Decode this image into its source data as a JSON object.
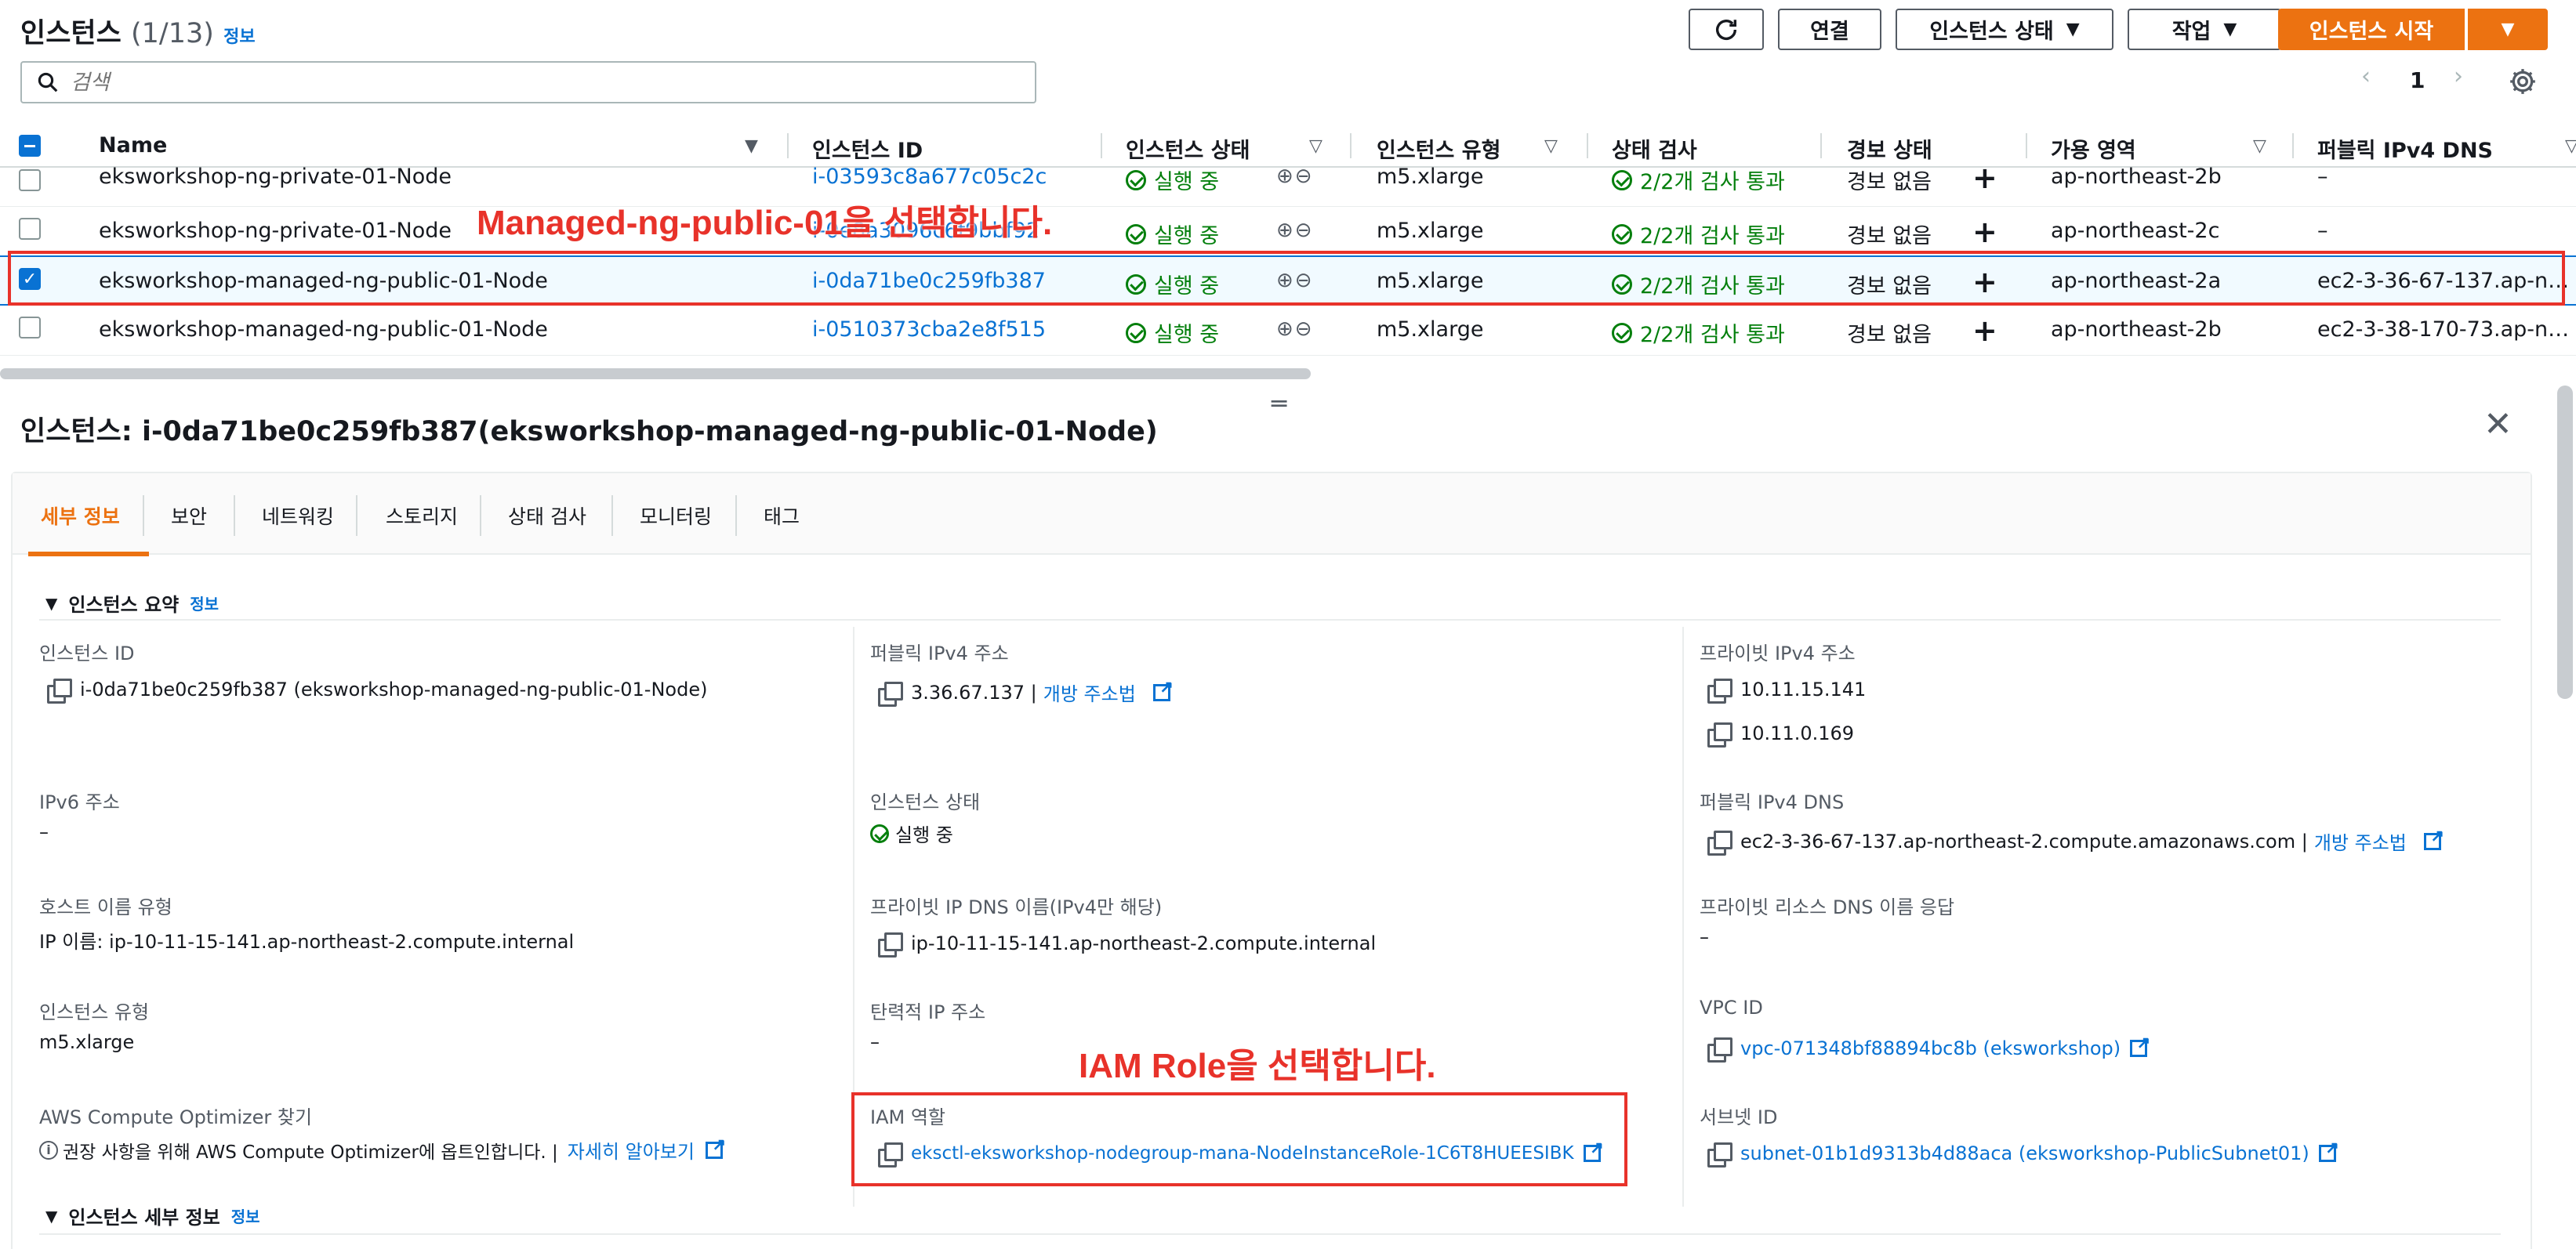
{
  "header": {
    "title": "인스턴스",
    "count": "(1/13)",
    "info": "정보",
    "buttons": {
      "connect": "연결",
      "instance_state": "인스턴스 상태",
      "actions": "작업",
      "launch": "인스턴스 시작"
    },
    "search_placeholder": "검색",
    "page": "1"
  },
  "table": {
    "columns": [
      "Name",
      "인스턴스 ID",
      "인스턴스 상태",
      "인스턴스 유형",
      "상태 검사",
      "경보 상태",
      "가용 영역",
      "퍼블릭 IPv4 DNS"
    ],
    "rows": [
      {
        "name": "eksworkshop-ng-private-01-Node",
        "id": "i-03593c8a677c05c2c",
        "state": "실행 중",
        "type": "m5.xlarge",
        "check": "2/2개 검사 통과",
        "alarm": "경보 없음",
        "az": "ap-northeast-2b",
        "dns": "–",
        "checked": false
      },
      {
        "name": "eksworkshop-ng-private-01-Node",
        "id": "i-0e8a3096c6f9bbf92",
        "state": "실행 중",
        "type": "m5.xlarge",
        "check": "2/2개 검사 통과",
        "alarm": "경보 없음",
        "az": "ap-northeast-2c",
        "dns": "–",
        "checked": false
      },
      {
        "name": "eksworkshop-managed-ng-public-01-Node",
        "id": "i-0da71be0c259fb387",
        "state": "실행 중",
        "type": "m5.xlarge",
        "check": "2/2개 검사 통과",
        "alarm": "경보 없음",
        "az": "ap-northeast-2a",
        "dns": "ec2-3-36-67-137.ap-no...",
        "checked": true
      },
      {
        "name": "eksworkshop-managed-ng-public-01-Node",
        "id": "i-0510373cba2e8f515",
        "state": "실행 중",
        "type": "m5.xlarge",
        "check": "2/2개 검사 통과",
        "alarm": "경보 없음",
        "az": "ap-northeast-2b",
        "dns": "ec2-3-38-170-73.ap-no...",
        "checked": false
      }
    ]
  },
  "annotations": {
    "row": "Managed-ng-public-01을 선택합니다.",
    "iam": "IAM Role을 선택합니다."
  },
  "detail": {
    "title": "인스턴스: i-0da71be0c259fb387(eksworkshop-managed-ng-public-01-Node)",
    "tabs": [
      "세부 정보",
      "보안",
      "네트워킹",
      "스토리지",
      "상태 검사",
      "모니터링",
      "태그"
    ],
    "summary_heading": "인스턴스 요약",
    "summary_info": "정보",
    "details_heading": "인스턴스 세부 정보",
    "details_info": "정보",
    "fields": {
      "instance_id_label": "인스턴스 ID",
      "instance_id_value": "i-0da71be0c259fb387 (eksworkshop-managed-ng-public-01-Node)",
      "public_ipv4_label": "퍼블릭 IPv4 주소",
      "public_ipv4_value": "3.36.67.137 |",
      "open_address": "개방 주소법",
      "private_ipv4_label": "프라이빗 IPv4 주소",
      "private_ipv4_1": "10.11.15.141",
      "private_ipv4_2": "10.11.0.169",
      "ipv6_label": "IPv6 주소",
      "ipv6_value": "–",
      "instance_state_label": "인스턴스 상태",
      "instance_state_value": "실행 중",
      "public_dns_label": "퍼블릭 IPv4 DNS",
      "public_dns_value": "ec2-3-36-67-137.ap-northeast-2.compute.amazonaws.com |",
      "hostname_type_label": "호스트 이름 유형",
      "hostname_type_value": "IP 이름: ip-10-11-15-141.ap-northeast-2.compute.internal",
      "private_dns_label": "프라이빗 IP DNS 이름(IPv4만 해당)",
      "private_dns_value": "ip-10-11-15-141.ap-northeast-2.compute.internal",
      "private_resource_dns_label": "프라이빗 리소스 DNS 이름 응답",
      "private_resource_dns_value": "–",
      "instance_type_label": "인스턴스 유형",
      "instance_type_value": "m5.xlarge",
      "elastic_ip_label": "탄력적 IP 주소",
      "elastic_ip_value": "–",
      "vpc_label": "VPC ID",
      "vpc_value": "vpc-071348bf88894bc8b (eksworkshop)",
      "optimizer_label": "AWS Compute Optimizer 찾기",
      "optimizer_value": "권장 사항을 위해 AWS Compute Optimizer에 옵트인합니다. |",
      "optimizer_link": "자세히 알아보기",
      "iam_label": "IAM 역할",
      "iam_value": "eksctl-eksworkshop-nodegroup-mana-NodeInstanceRole-1C6T8HUEESIBK",
      "subnet_label": "서브넷 ID",
      "subnet_value": "subnet-01b1d9313b4d88aca (eksworkshop-PublicSubnet01)"
    }
  },
  "colors": {
    "accent": "#ec7211",
    "link": "#0972d3",
    "ok": "#037f0c",
    "annotation": "#e8322a"
  }
}
